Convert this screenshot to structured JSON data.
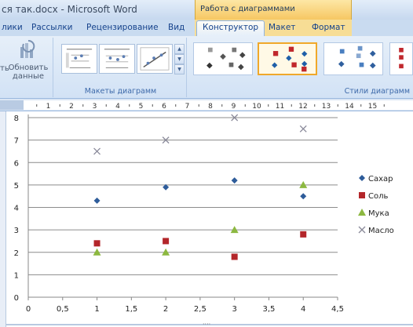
{
  "window": {
    "title": "ся так.docx - Microsoft Word",
    "context_header": "Работа с диаграммами"
  },
  "tabs": [
    {
      "label": "лики"
    },
    {
      "label": "Рассылки"
    },
    {
      "label": "Рецензирование"
    },
    {
      "label": "Вид"
    },
    {
      "label": "Конструктор",
      "active": true
    },
    {
      "label": "Макет"
    },
    {
      "label": "Формат"
    }
  ],
  "ribbon": {
    "refresh": {
      "line1": "Обновить",
      "line2": "данные",
      "left_fragment": "ть"
    },
    "layouts_group_label": "Макеты диаграмм",
    "styles_group_label": "Стили диаграмм"
  },
  "ruler": {
    "labels": [
      "1",
      "2",
      "3",
      "4",
      "5",
      "6",
      "7",
      "8",
      "9",
      "10",
      "11",
      "12",
      "13",
      "14",
      "15"
    ]
  },
  "chart_data": {
    "type": "scatter",
    "xlim": [
      0,
      4.5
    ],
    "ylim": [
      0,
      8
    ],
    "x_ticks": [
      "0",
      "0,5",
      "1",
      "1,5",
      "2",
      "2,5",
      "3",
      "3,5",
      "4",
      "4,5"
    ],
    "y_ticks": [
      "0",
      "1",
      "2",
      "3",
      "4",
      "5",
      "6",
      "7",
      "8"
    ],
    "grid": true,
    "legend_position": "right",
    "series": [
      {
        "name": "Сахар",
        "marker": "diamond",
        "color": "#2e5c9a",
        "points": [
          [
            1,
            4.3
          ],
          [
            2,
            4.9
          ],
          [
            3,
            5.2
          ],
          [
            4,
            4.5
          ]
        ]
      },
      {
        "name": "Соль",
        "marker": "square",
        "color": "#b3262a",
        "points": [
          [
            1,
            2.4
          ],
          [
            2,
            2.5
          ],
          [
            3,
            1.8
          ],
          [
            4,
            2.8
          ]
        ]
      },
      {
        "name": "Мука",
        "marker": "triangle",
        "color": "#8cb840",
        "points": [
          [
            1,
            2.0
          ],
          [
            2,
            2.0
          ],
          [
            3,
            3.0
          ],
          [
            4,
            5.0
          ]
        ]
      },
      {
        "name": "Масло",
        "marker": "x",
        "color": "#8a8a9a",
        "points": [
          [
            1,
            6.5
          ],
          [
            2,
            7.0
          ],
          [
            3,
            8.0
          ],
          [
            4,
            7.5
          ]
        ]
      }
    ]
  }
}
